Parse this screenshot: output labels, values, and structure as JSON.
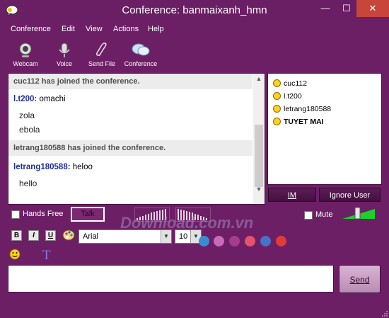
{
  "window": {
    "title": "Conference:  banmaixanh_hmn",
    "minimize": "—",
    "maximize": "☐",
    "close": "✕"
  },
  "menu": [
    "Conference",
    "Edit",
    "View",
    "Actions",
    "Help"
  ],
  "toolbar": [
    {
      "label": "Webcam",
      "icon": "webcam-icon"
    },
    {
      "label": "Voice",
      "icon": "microphone-icon"
    },
    {
      "label": "Send File",
      "icon": "paperclip-icon"
    },
    {
      "label": "Conference",
      "icon": "conference-icon"
    }
  ],
  "chat": {
    "sys1": "cuc112 has joined the conference.",
    "msg1_nick": "l.t200:",
    "msg1_text": " omachi",
    "line1": "zola",
    "line2": "ebola",
    "sys2": "letrang180588 has joined the conference.",
    "msg2_nick": "letrang180588:",
    "msg2_text": " heloo",
    "line3": "hello"
  },
  "users": [
    {
      "name": "cuc112",
      "bold": false
    },
    {
      "name": "l.t200",
      "bold": false
    },
    {
      "name": "letrang180588",
      "bold": false
    },
    {
      "name": "TUYET MAI",
      "bold": true
    }
  ],
  "buttons": {
    "im": "IM",
    "ignore": "Ignore User",
    "send": "Send"
  },
  "audio": {
    "hands_free": "Hands Free",
    "talk": "Talk",
    "mute": "Mute"
  },
  "format": {
    "bold": "B",
    "italic": "I",
    "underline": "U",
    "font": "Arial",
    "size": "10"
  },
  "emoji_row": {
    "text_style_glyph": "T"
  },
  "watermark": "Download.com.vn",
  "colors": {
    "window_bg": "#6d1f66",
    "nick": "#1e2f96",
    "dots": [
      "#3a8bd6",
      "#c96ab8",
      "#a63c8e",
      "#e5536b",
      "#4672c9",
      "#e23a3a"
    ]
  }
}
